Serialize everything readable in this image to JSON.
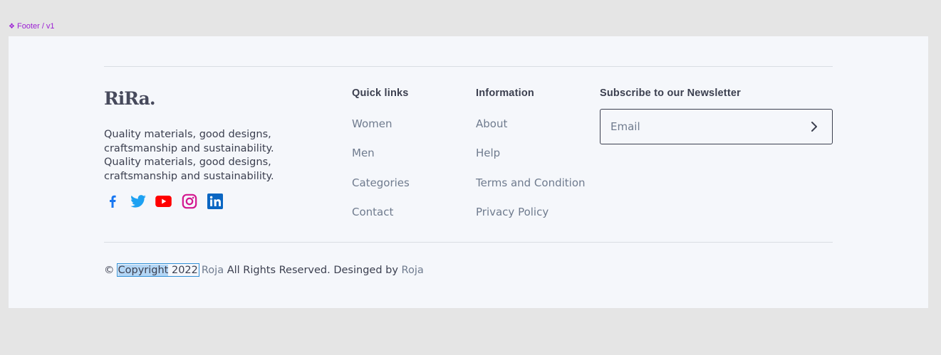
{
  "frame": {
    "label": "Footer / v1",
    "label_icon": "component-icon"
  },
  "brand": {
    "logo": "RiRa."
  },
  "tagline": "Quality materials, good designs, craftsmanship and sustainability. Quality materials, good designs, craftsmanship and sustainability.",
  "socials": [
    {
      "name": "facebook-icon",
      "color": "#1877f2"
    },
    {
      "name": "twitter-icon",
      "color": "#1da1f2"
    },
    {
      "name": "youtube-icon",
      "color": "#ff0000"
    },
    {
      "name": "instagram-icon",
      "color": "#d3168f"
    },
    {
      "name": "linkedin-icon",
      "color": "#0a66c2"
    }
  ],
  "quick_links": {
    "title": "Quick links",
    "items": [
      "Women",
      "Men",
      "Categories",
      "Contact"
    ]
  },
  "information": {
    "title": "Information",
    "items": [
      "About",
      "Help",
      "Terms and Condition",
      "Privacy Policy"
    ]
  },
  "newsletter": {
    "title": "Subscribe to our Newsletter",
    "email_placeholder": "Email",
    "submit_icon": "chevron-right-icon"
  },
  "copyright": {
    "symbol": "©",
    "word": "Copyright",
    "year": "2022",
    "owner": "Roja",
    "rights": "All Rights Reserved. Desinged by",
    "designer": "Roja"
  },
  "colors": {
    "frame_bg": "#f5f7fb",
    "canvas_bg": "#e5e5e5",
    "text": "#3b3f4f",
    "muted": "#6f7b8e",
    "label": "#9b1fd3",
    "selection": "#2f8fd6"
  }
}
